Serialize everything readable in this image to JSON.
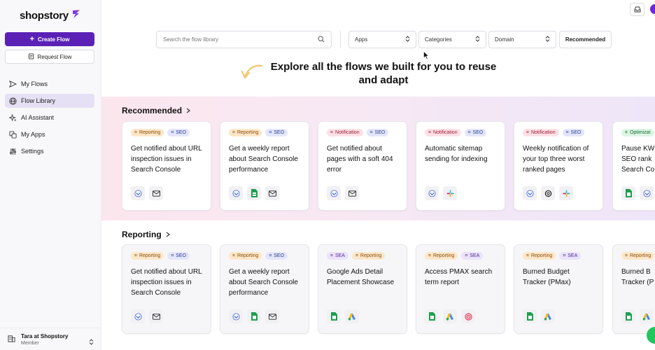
{
  "sidebar": {
    "logo": "shopstory",
    "create_flow": "Create Flow",
    "request_flow": "Request Flow",
    "nav": [
      {
        "label": "My Flows",
        "icon": "send-icon"
      },
      {
        "label": "Flow Library",
        "icon": "globe-icon"
      },
      {
        "label": "AI Assistant",
        "icon": "sparkles-icon"
      },
      {
        "label": "My Apps",
        "icon": "apps-icon"
      },
      {
        "label": "Settings",
        "icon": "sliders-icon"
      }
    ],
    "user": {
      "name": "Tara at Shopstory",
      "role": "Member"
    }
  },
  "toolbar": {
    "search_placeholder": "Search the flow library",
    "apps": "Apps",
    "categories": "Categories",
    "domain": "Domain",
    "recommended": "Recommended"
  },
  "headline": "Explore all the flows we built for you to reuse and adapt",
  "colors": {
    "accent": "#5b21b6",
    "reporting": "#fde7c9",
    "seo": "#e3e6fb",
    "notification": "#fde1e6",
    "sea": "#ebe3fb"
  },
  "recommended": {
    "title": "Recommended",
    "cards": [
      {
        "badges": [
          "Reporting",
          "SEO"
        ],
        "title": "Get notified about URL inspection issues in Search Console",
        "apps": [
          "search-console-icon",
          "mail-icon"
        ]
      },
      {
        "badges": [
          "Reporting",
          "SEO"
        ],
        "title": "Get a weekly report about Search Console performance",
        "apps": [
          "search-console-icon",
          "google-sheets-icon",
          "mail-icon"
        ]
      },
      {
        "badges": [
          "Notification",
          "SEO"
        ],
        "title": "Get notified about pages with a soft 404 error",
        "apps": [
          "search-console-icon",
          "mail-icon"
        ]
      },
      {
        "badges": [
          "Notification",
          "SEO"
        ],
        "title": "Automatic sitemap sending for indexing",
        "apps": [
          "search-console-icon",
          "slack-icon"
        ]
      },
      {
        "badges": [
          "Notification",
          "SEO"
        ],
        "title": "Weekly notification of your top three worst ranked pages",
        "apps": [
          "search-console-icon",
          "openai-icon",
          "slack-icon"
        ]
      },
      {
        "badges": [
          "Optimizat"
        ],
        "title": "Pause KW SEO rank Search Co",
        "apps": [
          "google-sheets-icon",
          "search-console-icon"
        ]
      }
    ]
  },
  "reporting": {
    "title": "Reporting",
    "cards": [
      {
        "badges": [
          "Reporting",
          "SEO"
        ],
        "title": "Get notified about URL inspection issues in Search Console",
        "apps": [
          "search-console-icon",
          "mail-icon"
        ]
      },
      {
        "badges": [
          "Reporting",
          "SEO"
        ],
        "title": "Get a weekly report about Search Console performance",
        "apps": [
          "search-console-icon",
          "google-sheets-icon",
          "mail-icon"
        ]
      },
      {
        "badges": [
          "SEA",
          "Reporting"
        ],
        "title": "Google Ads Detail Placement Showcase",
        "apps": [
          "google-sheets-icon",
          "google-ads-icon"
        ]
      },
      {
        "badges": [
          "Reporting",
          "SEA"
        ],
        "title": "Access PMAX search term report",
        "apps": [
          "google-sheets-icon",
          "google-ads-icon",
          "target-icon"
        ]
      },
      {
        "badges": [
          "Reporting",
          "SEA"
        ],
        "title": "Burned Budget Tracker (PMax)",
        "apps": [
          "google-sheets-icon",
          "google-ads-icon"
        ]
      },
      {
        "badges": [
          "Reporting"
        ],
        "title": "Burned B Tracker (P",
        "apps": [
          "google-sheets-icon",
          "google-ads-icon"
        ]
      }
    ]
  }
}
